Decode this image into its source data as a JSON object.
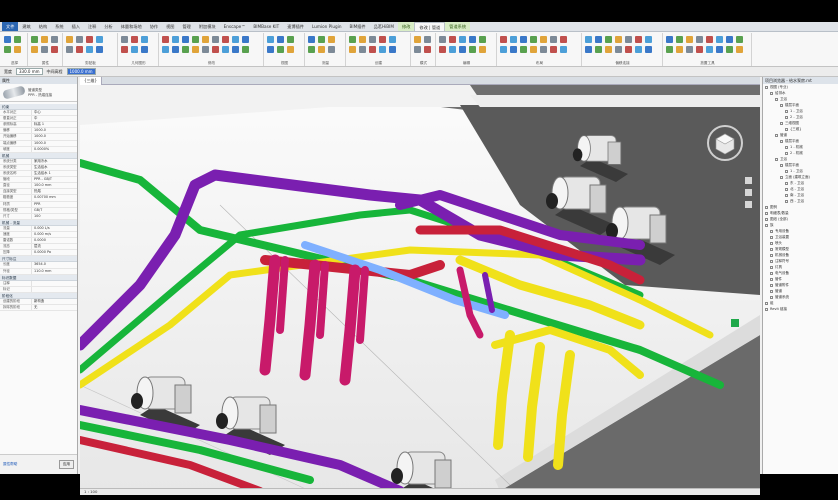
{
  "ribbon_tabs": [
    "文件",
    "建筑",
    "结构",
    "系统",
    "插入",
    "注释",
    "分析",
    "体量和场地",
    "协作",
    "视图",
    "管理",
    "附加模块",
    "Enscape™",
    "BIMBase KIT",
    "速博插件",
    "Lumion Plugin",
    "BIM插件",
    "品茗HiBIM",
    "修改",
    "修改 | 管道",
    "管道系统"
  ],
  "active_tab_index": 19,
  "ribbon_groups": [
    "选择",
    "属性",
    "剪贴板",
    "几何图形",
    "修改",
    "视图",
    "测量",
    "创建",
    "模式",
    "编辑",
    "布局",
    "偏移连接",
    "放置工具"
  ],
  "options_bar": {
    "label_w": "宽度",
    "field_w": "330.0 mm",
    "label_offset": "中间高程",
    "field_offset": "1000.0 mm"
  },
  "properties": {
    "title": "属性",
    "type_line1": "管道类型",
    "type_line2": "PPR - 热熔连接",
    "rows": [
      {
        "g": "约束"
      },
      {
        "k": "水平对正",
        "v": "中心"
      },
      {
        "k": "垂直对正",
        "v": "中"
      },
      {
        "k": "参照标高",
        "v": "标高 1"
      },
      {
        "k": "偏移",
        "v": "1000.0"
      },
      {
        "k": "开始偏移",
        "v": "1000.0"
      },
      {
        "k": "端点偏移",
        "v": "1000.0"
      },
      {
        "k": "坡度",
        "v": "0.0000%"
      },
      {
        "g": "机械"
      },
      {
        "k": "系统分类",
        "v": "家用冷水"
      },
      {
        "k": "系统类型",
        "v": "生活给水"
      },
      {
        "k": "系统名称",
        "v": "生活给水 1"
      },
      {
        "k": "管段",
        "v": "PPR - GB/T"
      },
      {
        "k": "直径",
        "v": "100.0 mm"
      },
      {
        "k": "连接类型",
        "v": "热熔"
      },
      {
        "k": "粗糙度",
        "v": "0.00700 mm"
      },
      {
        "k": "材质",
        "v": "PPR"
      },
      {
        "k": "规格/类型",
        "v": "GB/T"
      },
      {
        "k": "尺寸",
        "v": "100"
      },
      {
        "g": "机械 - 流量"
      },
      {
        "k": "流量",
        "v": "0.000 L/s"
      },
      {
        "k": "速度",
        "v": "0.000 m/s"
      },
      {
        "k": "雷诺数",
        "v": "0.0000"
      },
      {
        "k": "流态",
        "v": "层流"
      },
      {
        "k": "压降",
        "v": "0.0000 Pa"
      },
      {
        "g": "尺寸标注"
      },
      {
        "k": "长度",
        "v": "3654.0"
      },
      {
        "k": "外径",
        "v": "110.0 mm"
      },
      {
        "g": "标识数据"
      },
      {
        "k": "注释",
        "v": ""
      },
      {
        "k": "标记",
        "v": ""
      },
      {
        "g": "阶段化"
      },
      {
        "k": "创建的阶段",
        "v": "新构造"
      },
      {
        "k": "拆除的阶段",
        "v": "无"
      }
    ],
    "help": "属性帮助",
    "apply": "应用"
  },
  "view": {
    "tab": "{三维}",
    "status": "1 : 100"
  },
  "browser": {
    "title": "项目浏览器 - 给水泵房.rvt",
    "nodes": [
      {
        "t": "视图 (专业)",
        "d": 0
      },
      {
        "t": "给排水",
        "d": 1
      },
      {
        "t": "卫浴",
        "d": 2
      },
      {
        "t": "楼层平面",
        "d": 3
      },
      {
        "t": "1 - 卫浴",
        "d": 4
      },
      {
        "t": "2 - 卫浴",
        "d": 4
      },
      {
        "t": "三维视图",
        "d": 3
      },
      {
        "t": "{三维}",
        "d": 4
      },
      {
        "t": "管道",
        "d": 2
      },
      {
        "t": "楼层平面",
        "d": 3
      },
      {
        "t": "1 - 机械",
        "d": 4
      },
      {
        "t": "2 - 机械",
        "d": 4
      },
      {
        "t": "卫浴",
        "d": 2
      },
      {
        "t": "楼层平面",
        "d": 3
      },
      {
        "t": "1 - 卫浴",
        "d": 4
      },
      {
        "t": "立面 (建筑立面)",
        "d": 3
      },
      {
        "t": "东 - 卫浴",
        "d": 4
      },
      {
        "t": "北 - 卫浴",
        "d": 4
      },
      {
        "t": "南 - 卫浴",
        "d": 4
      },
      {
        "t": "西 - 卫浴",
        "d": 4
      },
      {
        "t": "图例",
        "d": 0
      },
      {
        "t": "明细表/数量",
        "d": 0
      },
      {
        "t": "图纸 (全部)",
        "d": 0
      },
      {
        "t": "族",
        "d": 0
      },
      {
        "t": "专用设备",
        "d": 1
      },
      {
        "t": "卫浴装置",
        "d": 1
      },
      {
        "t": "喷头",
        "d": 1
      },
      {
        "t": "常规模型",
        "d": 1
      },
      {
        "t": "机械设备",
        "d": 1
      },
      {
        "t": "注释符号",
        "d": 1
      },
      {
        "t": "灯具",
        "d": 1
      },
      {
        "t": "电气设备",
        "d": 1
      },
      {
        "t": "管件",
        "d": 1
      },
      {
        "t": "管道附件",
        "d": 1
      },
      {
        "t": "管道",
        "d": 1
      },
      {
        "t": "管道系统",
        "d": 1
      },
      {
        "t": "组",
        "d": 0
      },
      {
        "t": "Revit 链接",
        "d": 0
      }
    ]
  },
  "colors": {
    "purple": "#7a1fb0",
    "green": "#17b53a",
    "yellow": "#f0e11a",
    "red": "#c8213a",
    "magenta": "#c81a6a",
    "blue_selected": "#7fb0ff"
  }
}
